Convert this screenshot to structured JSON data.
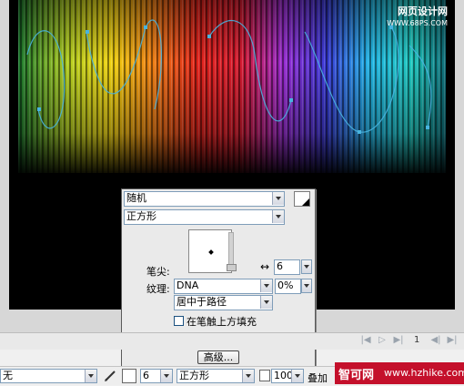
{
  "watermark": {
    "site": "网页设计网",
    "url": "WWW.68PS.COM"
  },
  "panel": {
    "category": "随机",
    "tip_shape": "正方形",
    "tip_label": "笔尖:",
    "tip_size": "6",
    "texture_label": "纹理:",
    "texture": "DNA",
    "texture_amount": "0%",
    "placement": "居中于路径",
    "fill_over_label": "在笔触上方填充",
    "advanced_label": "高级..."
  },
  "navigation": {
    "page": "1"
  },
  "property_bar": {
    "fill": "无",
    "stroke_size": "6",
    "tip_shape": "正方形",
    "opacity": "100",
    "blend": "叠加"
  },
  "brand_badge": {
    "name": "智可网",
    "url": "www.hzhike.com"
  },
  "icons": {
    "pencil": "pencil-icon",
    "stroke_color": "stroke-color-swatch",
    "size_arrows": "horizontal-arrows-icon",
    "new_style": "new-style-icon",
    "delete": "trash-icon"
  },
  "colors": {
    "panel_bg": "#eaeaea",
    "badge_red": "#c4102b",
    "canvas_bg": "#000000"
  }
}
